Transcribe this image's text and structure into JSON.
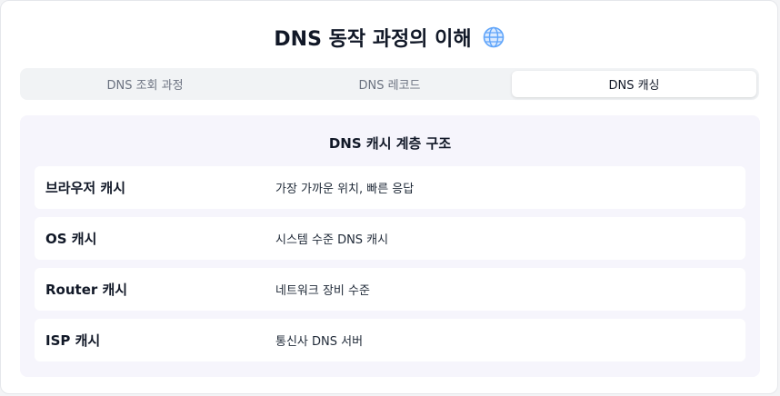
{
  "header": {
    "title": "DNS 동작 과정의 이해",
    "icon": "globe-icon"
  },
  "tabs": [
    {
      "label": "DNS 조회 과정",
      "active": false
    },
    {
      "label": "DNS 레코드",
      "active": false
    },
    {
      "label": "DNS 캐싱",
      "active": true
    }
  ],
  "panel": {
    "title": "DNS 캐시 계층 구조",
    "rows": [
      {
        "name": "브라우저 캐시",
        "desc": "가장 가까운 위치, 빠른 응답"
      },
      {
        "name": "OS 캐시",
        "desc": "시스템 수준 DNS 캐시"
      },
      {
        "name": "Router 캐시",
        "desc": "네트워크 장비 수준"
      },
      {
        "name": "ISP 캐시",
        "desc": "통신사 DNS 서버"
      }
    ]
  },
  "colors": {
    "accent_globe": "#60a5fa",
    "panel_bg": "#f6f5fc",
    "tabs_bg": "#f1f3f5"
  }
}
